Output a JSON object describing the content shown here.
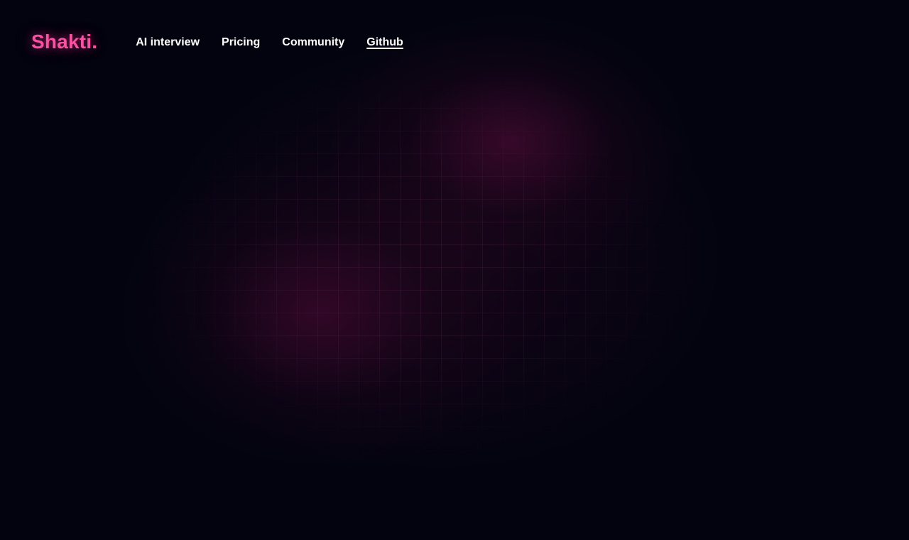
{
  "brand": {
    "name": "Shakti.",
    "color": "#ff4fa3"
  },
  "nav": {
    "links": [
      {
        "label": "AI interview",
        "active": false
      },
      {
        "label": "Pricing",
        "active": false
      },
      {
        "label": "Community",
        "active": false
      },
      {
        "label": "Github",
        "active": true
      }
    ]
  },
  "theme": {
    "background": "#02030f",
    "glow": "#5a0c3c",
    "grid_line": "#78326a"
  }
}
